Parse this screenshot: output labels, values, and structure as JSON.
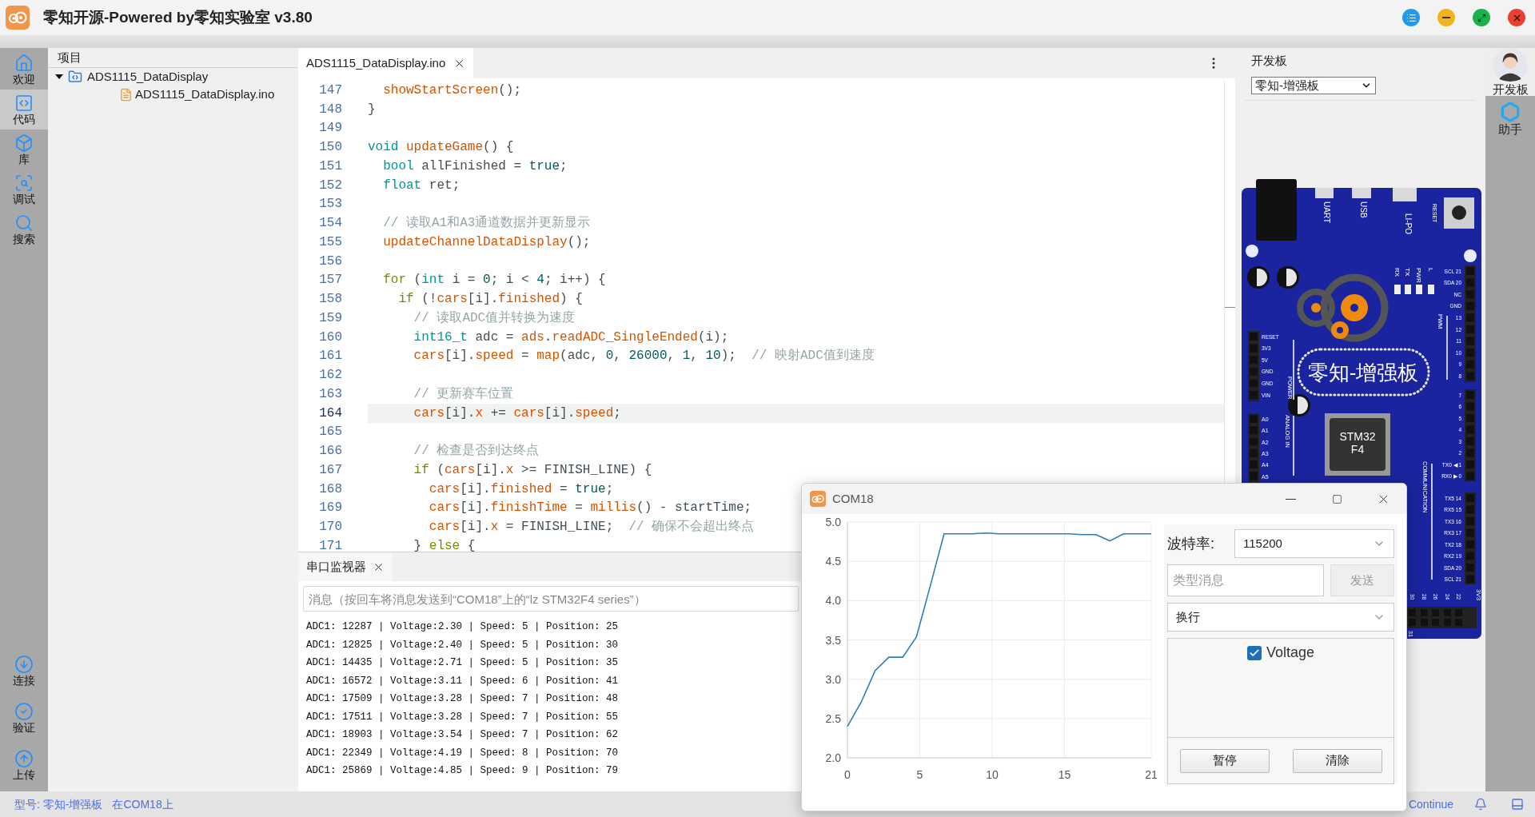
{
  "window": {
    "title": "零知开源-Powered by零知实验室 v3.80"
  },
  "left_sidebar": {
    "top_items": [
      {
        "label": "欢迎",
        "selected": false
      },
      {
        "label": "代码",
        "selected": true
      },
      {
        "label": "库",
        "selected": false
      },
      {
        "label": "调试",
        "selected": false
      },
      {
        "label": "搜索",
        "selected": false
      }
    ],
    "bottom_items": [
      {
        "label": "连接",
        "selected": false
      },
      {
        "label": "验证",
        "selected": false
      },
      {
        "label": "上传",
        "selected": false
      }
    ]
  },
  "project_tree": {
    "header": "项目",
    "items": [
      {
        "label": "ADS1115_DataDisplay",
        "expanded": true,
        "children": [
          {
            "label": "ADS1115_DataDisplay.ino"
          }
        ]
      }
    ]
  },
  "editor": {
    "tabs": [
      {
        "label": "ADS1115_DataDisplay.ino",
        "selected": true
      }
    ],
    "lines": [
      {
        "number": "147",
        "selected": false,
        "tokens": [
          {
            "kind": "fn",
            "text": "  showStartScreen"
          },
          {
            "kind": "plain",
            "text": "();"
          }
        ]
      },
      {
        "number": "148",
        "selected": false,
        "tokens": [
          {
            "kind": "plain",
            "text": "}"
          }
        ]
      },
      {
        "number": "149",
        "selected": false
      },
      {
        "number": "150",
        "selected": false,
        "tokens": [
          {
            "kind": "kw",
            "text": "void"
          },
          {
            "kind": "fn",
            "text": " updateGame"
          },
          {
            "kind": "plain",
            "text": "() {"
          }
        ]
      },
      {
        "number": "151",
        "selected": false,
        "tokens": [
          {
            "kind": "kw",
            "text": "  bool"
          },
          {
            "kind": "plain",
            "text": " allFinished = "
          },
          {
            "kind": "num",
            "text": "true"
          },
          {
            "kind": "plain",
            "text": ";"
          }
        ]
      },
      {
        "number": "152",
        "selected": false,
        "tokens": [
          {
            "kind": "kw",
            "text": "  float"
          },
          {
            "kind": "plain",
            "text": " ret;"
          }
        ]
      },
      {
        "number": "153",
        "selected": false
      },
      {
        "number": "154",
        "selected": false,
        "tokens": [
          {
            "kind": "cmt",
            "text": "  // 读取A1和A3通道数据并更新显示"
          }
        ]
      },
      {
        "number": "155",
        "selected": false,
        "tokens": [
          {
            "kind": "fn",
            "text": "  updateChannelDataDisplay"
          },
          {
            "kind": "plain",
            "text": "();"
          }
        ]
      },
      {
        "number": "156",
        "selected": false
      },
      {
        "number": "157",
        "selected": false,
        "tokens": [
          {
            "kind": "ctrl",
            "text": "  for"
          },
          {
            "kind": "plain",
            "text": " ("
          },
          {
            "kind": "kw",
            "text": "int"
          },
          {
            "kind": "plain",
            "text": " i = "
          },
          {
            "kind": "num",
            "text": "0"
          },
          {
            "kind": "plain",
            "text": "; i < "
          },
          {
            "kind": "num",
            "text": "4"
          },
          {
            "kind": "plain",
            "text": "; i++) {"
          }
        ]
      },
      {
        "number": "158",
        "selected": false,
        "tokens": [
          {
            "kind": "ctrl",
            "text": "    if"
          },
          {
            "kind": "plain",
            "text": " (!"
          },
          {
            "kind": "fn",
            "text": "cars"
          },
          {
            "kind": "plain",
            "text": "[i]."
          },
          {
            "kind": "fn",
            "text": "finished"
          },
          {
            "kind": "plain",
            "text": ") {"
          }
        ]
      },
      {
        "number": "159",
        "selected": false,
        "tokens": [
          {
            "kind": "cmt",
            "text": "      // 读取ADC值并转换为速度"
          }
        ]
      },
      {
        "number": "160",
        "selected": false,
        "tokens": [
          {
            "kind": "kw",
            "text": "      int16_t"
          },
          {
            "kind": "plain",
            "text": " adc = "
          },
          {
            "kind": "fn",
            "text": "ads"
          },
          {
            "kind": "plain",
            "text": "."
          },
          {
            "kind": "fn",
            "text": "readADC_SingleEnded"
          },
          {
            "kind": "plain",
            "text": "(i);"
          }
        ]
      },
      {
        "number": "161",
        "selected": false,
        "tokens": [
          {
            "kind": "fn",
            "text": "      cars"
          },
          {
            "kind": "plain",
            "text": "[i]."
          },
          {
            "kind": "fn",
            "text": "speed"
          },
          {
            "kind": "plain",
            "text": " = "
          },
          {
            "kind": "fn",
            "text": "map"
          },
          {
            "kind": "plain",
            "text": "(adc, "
          },
          {
            "kind": "num",
            "text": "0"
          },
          {
            "kind": "plain",
            "text": ", "
          },
          {
            "kind": "num",
            "text": "26000"
          },
          {
            "kind": "plain",
            "text": ", "
          },
          {
            "kind": "num",
            "text": "1"
          },
          {
            "kind": "plain",
            "text": ", "
          },
          {
            "kind": "num",
            "text": "10"
          },
          {
            "kind": "plain",
            "text": ");"
          },
          {
            "kind": "cmt",
            "text": "  // 映射ADC值到速度"
          }
        ]
      },
      {
        "number": "162",
        "selected": false
      },
      {
        "number": "163",
        "selected": false,
        "tokens": [
          {
            "kind": "cmt",
            "text": "      // 更新赛车位置"
          }
        ]
      },
      {
        "number": "164",
        "selected": true,
        "tokens": [
          {
            "kind": "fn",
            "text": "      cars"
          },
          {
            "kind": "plain",
            "text": "[i]."
          },
          {
            "kind": "fn",
            "text": "x"
          },
          {
            "kind": "plain",
            "text": " += "
          },
          {
            "kind": "fn",
            "text": "cars"
          },
          {
            "kind": "plain",
            "text": "[i]."
          },
          {
            "kind": "fn",
            "text": "speed"
          },
          {
            "kind": "plain",
            "text": ";"
          }
        ]
      },
      {
        "number": "165",
        "selected": false
      },
      {
        "number": "166",
        "selected": false,
        "tokens": [
          {
            "kind": "cmt",
            "text": "      // 检查是否到达终点"
          }
        ]
      },
      {
        "number": "167",
        "selected": false,
        "tokens": [
          {
            "kind": "ctrl",
            "text": "      if"
          },
          {
            "kind": "plain",
            "text": " ("
          },
          {
            "kind": "fn",
            "text": "cars"
          },
          {
            "kind": "plain",
            "text": "[i]."
          },
          {
            "kind": "fn",
            "text": "x"
          },
          {
            "kind": "plain",
            "text": " >= FINISH_LINE) {"
          }
        ]
      },
      {
        "number": "168",
        "selected": false,
        "tokens": [
          {
            "kind": "fn",
            "text": "        cars"
          },
          {
            "kind": "plain",
            "text": "[i]."
          },
          {
            "kind": "fn",
            "text": "finished"
          },
          {
            "kind": "plain",
            "text": " = "
          },
          {
            "kind": "num",
            "text": "true"
          },
          {
            "kind": "plain",
            "text": ";"
          }
        ]
      },
      {
        "number": "169",
        "selected": false,
        "tokens": [
          {
            "kind": "fn",
            "text": "        cars"
          },
          {
            "kind": "plain",
            "text": "[i]."
          },
          {
            "kind": "fn",
            "text": "finishTime"
          },
          {
            "kind": "plain",
            "text": " = "
          },
          {
            "kind": "fn",
            "text": "millis"
          },
          {
            "kind": "plain",
            "text": "() - startTime;"
          }
        ]
      },
      {
        "number": "170",
        "selected": false,
        "tokens": [
          {
            "kind": "fn",
            "text": "        cars"
          },
          {
            "kind": "plain",
            "text": "[i]."
          },
          {
            "kind": "fn",
            "text": "x"
          },
          {
            "kind": "plain",
            "text": " = FINISH_LINE;"
          },
          {
            "kind": "cmt",
            "text": "  // 确保不会超出终点"
          }
        ]
      },
      {
        "number": "171",
        "selected": false,
        "tokens": [
          {
            "kind": "plain",
            "text": "      } "
          },
          {
            "kind": "ctrl",
            "text": "else"
          },
          {
            "kind": "plain",
            "text": " {"
          }
        ]
      }
    ]
  },
  "serial_monitor": {
    "tabs": [
      {
        "label": "串口监视器",
        "selected": true
      }
    ],
    "input": {
      "placeholder": "消息（按回车将消息发送到“COM18”上的“lz STM32F4 series”）"
    },
    "output": [
      "ADC1: 12287 | Voltage:2.30 | Speed: 5 | Position: 25",
      "ADC1: 12825 | Voltage:2.40 | Speed: 5 | Position: 30",
      "ADC1: 14435 | Voltage:2.71 | Speed: 5 | Position: 35",
      "ADC1: 16572 | Voltage:3.11 | Speed: 6 | Position: 41",
      "ADC1: 17509 | Voltage:3.28 | Speed: 7 | Position: 48",
      "ADC1: 17511 | Voltage:3.28 | Speed: 7 | Position: 55",
      "ADC1: 18903 | Voltage:3.54 | Speed: 7 | Position: 62",
      "ADC1: 22349 | Voltage:4.19 | Speed: 8 | Position: 70",
      "ADC1: 25869 | Voltage:4.85 | Speed: 9 | Position: 79"
    ]
  },
  "board_panel": {
    "label": "开发板",
    "selected_board": "零知-增强板",
    "board": {
      "connectors": [
        "UART",
        "USB",
        "LI-PO",
        "RESET"
      ],
      "leds": [
        "RX",
        "TX",
        "PWR",
        "L"
      ],
      "name": "零知-增强板",
      "chip": [
        "STM32",
        "F4"
      ],
      "power_pins": [
        "RESET",
        "3V3",
        "5V",
        "GND",
        "GND",
        "VIN"
      ],
      "analog_pins": [
        "A0",
        "A1",
        "A2",
        "A3",
        "A4",
        "A5"
      ],
      "upper_pins": [
        "SCL 21",
        "SDA 20",
        "NC",
        "GND",
        "13",
        "12",
        "11",
        "10",
        "9",
        "8"
      ],
      "lower_pins": [
        "7",
        "6",
        "5",
        "4",
        "3",
        "2",
        "TX0 ◀ 1",
        "RX0 ▶ 0"
      ],
      "comm_pins": [
        "TX5 14",
        "RX5 15",
        "TX3 16",
        "RX3 17",
        "TX2 18",
        "RX2 19",
        "SDA 20",
        "SCL 21"
      ],
      "sections": [
        "POWER",
        "ANALOG IN",
        "PWM",
        "COMMUNICATION"
      ],
      "bottom_pins": [
        "30",
        "28",
        "26",
        "24",
        "22"
      ],
      "corner_label": "3V3",
      "bottom_label": "31"
    }
  },
  "right_sidebar": {
    "items": [
      {
        "label": "开发板",
        "selected": true
      },
      {
        "label": "助手",
        "selected": false
      }
    ]
  },
  "status_bar": {
    "model": "型号: 零知-增强板",
    "port": "在COM18上",
    "continue": "Continue"
  },
  "plotter_window": {
    "title": "COM18",
    "chart_data": {
      "type": "line",
      "grid": true,
      "x": [
        0,
        0.95,
        1.91,
        2.86,
        3.82,
        4.77,
        5.73,
        6.68,
        7.64,
        8.59,
        9.55,
        10.5,
        11.45,
        12.41,
        13.36,
        14.32,
        15.27,
        16.23,
        17.18,
        18.14,
        19.09,
        20.05,
        21
      ],
      "series": [
        {
          "name": "Voltage",
          "color": "#2a7fba",
          "values": [
            2.4,
            2.71,
            3.11,
            3.28,
            3.28,
            3.54,
            4.19,
            4.85,
            4.85,
            4.85,
            4.86,
            4.85,
            4.85,
            4.85,
            4.85,
            4.85,
            4.85,
            4.84,
            4.84,
            4.76,
            4.85,
            4.85,
            4.85
          ]
        }
      ],
      "xlim": [
        0,
        21
      ],
      "ylim": [
        2,
        5
      ],
      "xticks": [
        0,
        5,
        10,
        15,
        21
      ],
      "yticks": [
        {
          "value": 2,
          "label": "2.0"
        },
        {
          "value": 2.5,
          "label": "2.5"
        },
        {
          "value": 3,
          "label": "3.0"
        },
        {
          "value": 3.5,
          "label": "3.5"
        },
        {
          "value": 4,
          "label": "4.0"
        },
        {
          "value": 4.5,
          "label": "4.5"
        },
        {
          "value": 5,
          "label": "5.0"
        }
      ]
    },
    "baud_label": "波特率:",
    "baud_value": "115200",
    "message": {
      "placeholder": "类型消息"
    },
    "send_button": {
      "label": "发送",
      "disabled": true
    },
    "line_ending": "换行",
    "series_list": [
      {
        "checked": true
      }
    ],
    "buttons": [
      "暂停",
      "清除"
    ]
  }
}
